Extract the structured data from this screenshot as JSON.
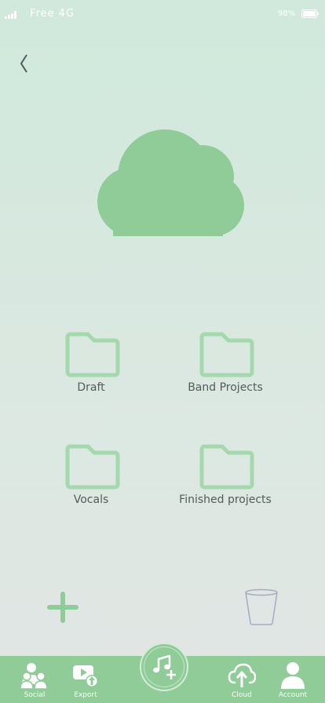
{
  "status_bar": {
    "carrier": "Free  4G",
    "battery": "98%"
  },
  "folders": [
    {
      "label": "Draft"
    },
    {
      "label": "Band Projects"
    },
    {
      "label": "Vocals"
    },
    {
      "label": "Finished projects"
    }
  ],
  "tab_bar": {
    "social": "Social",
    "export": "Export",
    "cloud": "Cloud",
    "account": "Account"
  },
  "colors": {
    "accent": "#8fcc98",
    "folder_stroke": "#a5d8ad",
    "text": "#555a5a",
    "trash_stroke": "#a3adc2"
  },
  "icons": {
    "back": "chevron-left-icon",
    "hero": "cloud-icon",
    "folder": "folder-icon",
    "add": "plus-icon",
    "delete": "trash-icon",
    "center": "music-add-icon"
  }
}
